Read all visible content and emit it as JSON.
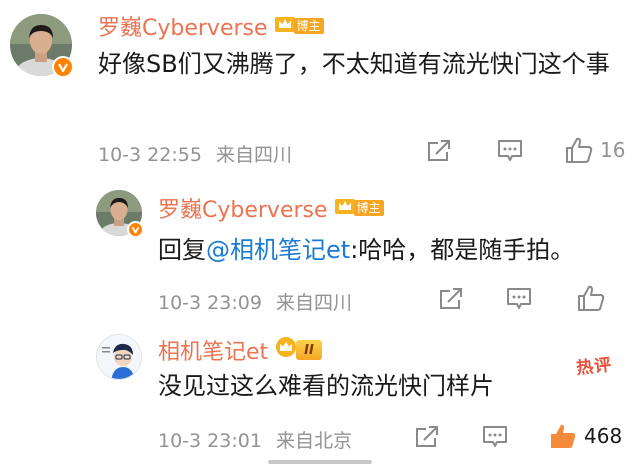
{
  "comments": [
    {
      "username": "罗巍Cyberverse",
      "badge": "博主",
      "text": "好像SB们又沸腾了，不太知道有流光快门这个事",
      "time": "10-3 22:55",
      "source": "来自四川",
      "likes": "16"
    },
    {
      "username": "罗巍Cyberverse",
      "badge": "博主",
      "reply_prefix": "回复",
      "mention": "@相机笔记et",
      "reply_text": ":哈哈，都是随手拍。",
      "time": "10-3 23:09",
      "source": "来自四川"
    },
    {
      "username": "相机笔记et",
      "rank_badge": "II",
      "hot_label": "热评",
      "text": "没见过这么难看的流光快门样片",
      "time": "10-3 23:01",
      "source": "来自北京",
      "likes": "468"
    }
  ],
  "colors": {
    "username": "#eb7350",
    "mention": "#1a7bd6",
    "meta": "#939393",
    "verified": "#ff8200",
    "liked": "#f58a3b"
  },
  "icons": [
    "verified-v-icon",
    "crown-icon",
    "share-icon",
    "comment-icon",
    "like-icon"
  ]
}
